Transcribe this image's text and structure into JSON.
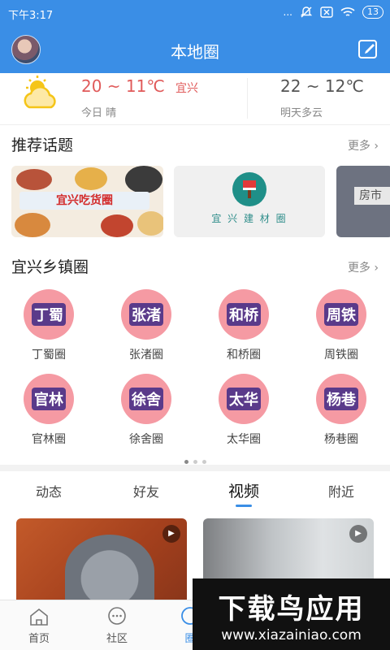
{
  "status_bar": {
    "time": "下午3:17",
    "more_dots": "...",
    "battery": "13"
  },
  "header": {
    "title": "本地圈"
  },
  "weather": {
    "today_temp": "20 ~ 11℃",
    "city": "宜兴",
    "today_desc": "今日 晴",
    "tomorrow_temp": "22 ~ 12℃",
    "tomorrow_desc": "明天多云"
  },
  "topics": {
    "title": "推荐话题",
    "more": "更多 ›",
    "cards": [
      {
        "label": "宜兴吃货圈"
      },
      {
        "label": "宜 兴 建 材 圈"
      },
      {
        "label": "房市"
      }
    ]
  },
  "towns": {
    "title": "宜兴乡镇圈",
    "more": "更多 ›",
    "items": [
      {
        "badge": "丁蜀",
        "label": "丁蜀圈"
      },
      {
        "badge": "张渚",
        "label": "张渚圈"
      },
      {
        "badge": "和桥",
        "label": "和桥圈"
      },
      {
        "badge": "周铁",
        "label": "周铁圈"
      },
      {
        "badge": "官林",
        "label": "官林圈"
      },
      {
        "badge": "徐舍",
        "label": "徐舍圈"
      },
      {
        "badge": "太华",
        "label": "太华圈"
      },
      {
        "badge": "杨巷",
        "label": "杨巷圈"
      }
    ],
    "pager": {
      "pages": 3,
      "current": 1
    }
  },
  "feed_tabs": [
    {
      "label": "动态"
    },
    {
      "label": "好友"
    },
    {
      "label": "视频"
    },
    {
      "label": "附近"
    }
  ],
  "feed_tabs_active": "视频",
  "videos": [
    {
      "play_icon": "play-icon"
    },
    {
      "play_icon": "play-icon"
    }
  ],
  "bottom_nav": [
    {
      "label": "首页",
      "icon": "home-icon"
    },
    {
      "label": "社区",
      "icon": "chat-icon"
    },
    {
      "label": "圈",
      "icon": "circle-icon"
    }
  ],
  "watermark": {
    "title": "下载鸟应用",
    "url": "www.xiazainiao.com"
  },
  "colors": {
    "primary": "#3a8ee6",
    "town_circle": "#f59aa3",
    "temp_red": "#e05a5a"
  }
}
